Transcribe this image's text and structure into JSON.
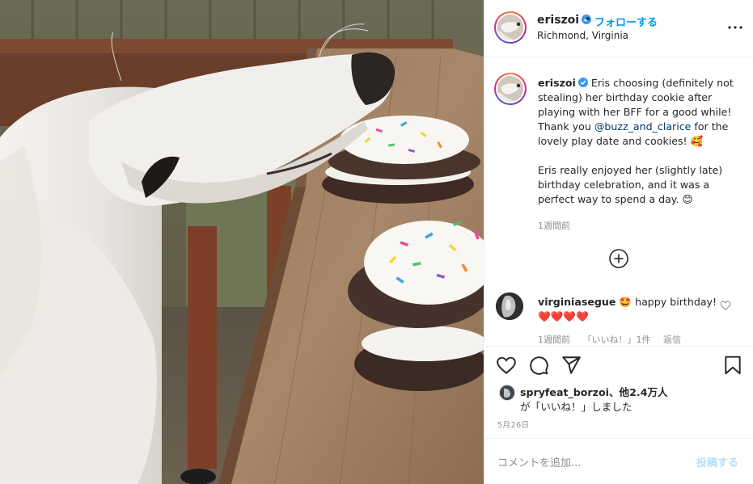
{
  "post": {
    "username": "eriszoi",
    "separator": "•",
    "follow_label": "フォローする",
    "location": "Richmond, Virginia",
    "caption": {
      "username": "eriszoi",
      "line1_before": " Eris choosing (definitely not stealing) her birthday cookie after playing with her BFF for a good while! Thank you ",
      "mention": "@buzz_and_clarice",
      "line1_after": " for the lovely play date and cookies! 🥰",
      "line2": "Eris really enjoyed her (slightly late) birthday celebration, and it was a perfect way to spend a day. 😊",
      "time_ago": "1週間前"
    },
    "comments": [
      {
        "username": "virginiasegue",
        "text": " 🤩 happy birthday! ❤️❤️❤️❤️",
        "time_ago": "1週間前",
        "likes_label": "「いいね！」1件",
        "reply_label": "返信"
      }
    ],
    "likes": {
      "liker": "spryfeat_borzoi",
      "others": "、他2.4万人",
      "suffix": "が「いいね！」しました"
    },
    "date": "5月26日",
    "comment_input": {
      "placeholder": "コメントを追加...",
      "post_label": "投稿する"
    }
  },
  "colors": {
    "accent": "#0095f6",
    "link": "#00376b",
    "muted": "#8e8e8e",
    "post_disabled": "#b2dffc",
    "border": "#efefef"
  },
  "icons": [
    "verified-icon",
    "more-options-icon",
    "load-more-icon",
    "heart-icon",
    "comment-icon",
    "share-icon",
    "save-icon",
    "small-heart-icon"
  ]
}
